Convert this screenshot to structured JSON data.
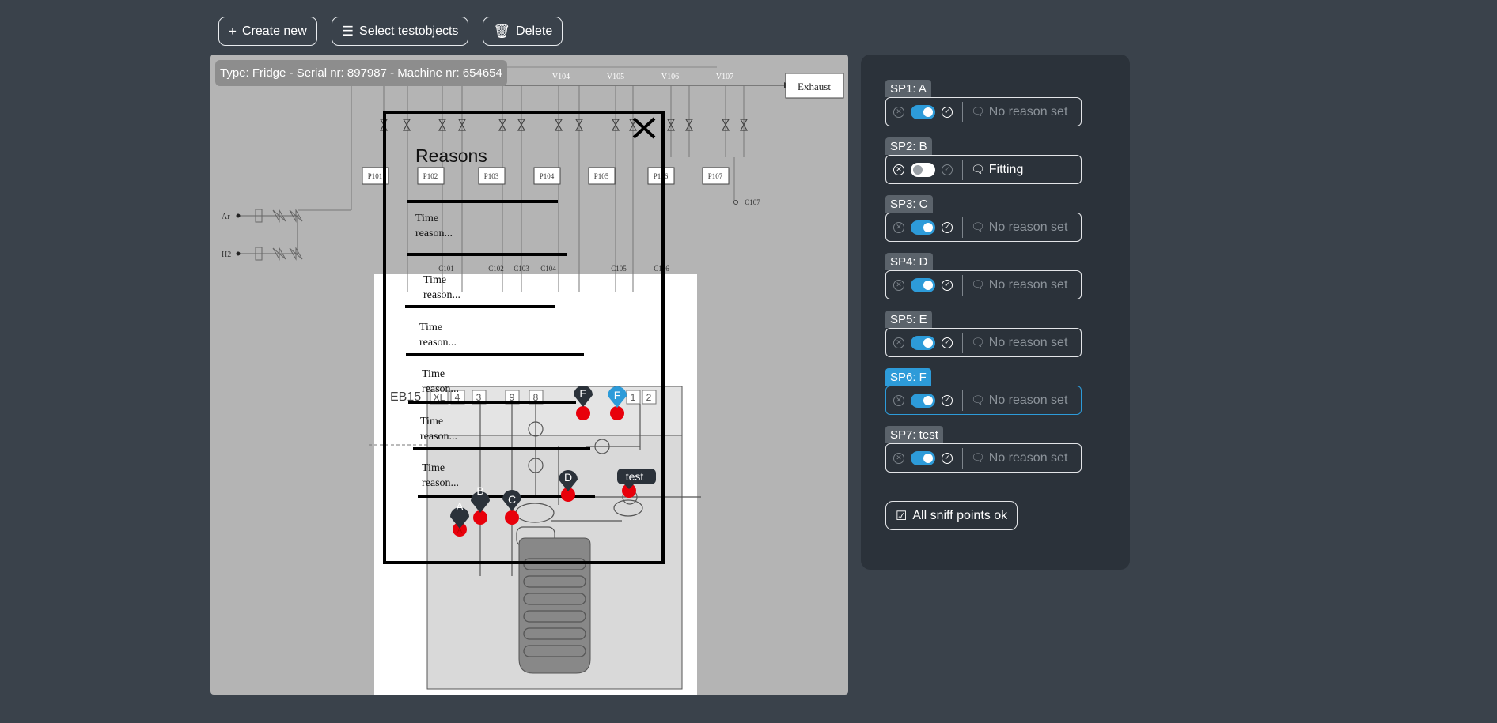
{
  "toolbar": {
    "create_label": "Create new",
    "select_label": "Select testobjects",
    "delete_label": "Delete"
  },
  "viewer": {
    "info": "Type: Fridge - Serial nr: 897987 - Machine nr: 654654",
    "diagram_labels": {
      "exhaust": "Exhaust",
      "ar": "Ar",
      "h2": "H2",
      "valves": [
        "V104",
        "V105",
        "V106",
        "V107"
      ],
      "pumps": [
        "P101",
        "P102",
        "P103",
        "P104",
        "P105",
        "P106",
        "P107"
      ],
      "columns": [
        "C101",
        "C102",
        "C103",
        "C104",
        "C105",
        "C106",
        "C107"
      ],
      "eb15": "EB15",
      "xl": "XL",
      "port_numbers": [
        "4",
        "3",
        "9",
        "8",
        "1",
        "2"
      ]
    },
    "reasons_overlay": {
      "title": "Reasons",
      "items": [
        "Time reason...",
        "Time reason...",
        "Time reason...",
        "Time reason...",
        "Time reason...",
        "Time reason..."
      ]
    },
    "markers": [
      "A",
      "B",
      "C",
      "D",
      "E",
      "F",
      "test"
    ],
    "selected_marker": "F"
  },
  "sniff_points": [
    {
      "label": "SP1: A",
      "enabled": true,
      "reason": "No reason set",
      "reason_set": false
    },
    {
      "label": "SP2: B",
      "enabled": false,
      "reason": "Fitting",
      "reason_set": true
    },
    {
      "label": "SP3: C",
      "enabled": true,
      "reason": "No reason set",
      "reason_set": false
    },
    {
      "label": "SP4: D",
      "enabled": true,
      "reason": "No reason set",
      "reason_set": false
    },
    {
      "label": "SP5: E",
      "enabled": true,
      "reason": "No reason set",
      "reason_set": false
    },
    {
      "label": "SP6: F",
      "enabled": true,
      "reason": "No reason set",
      "reason_set": false,
      "active": true
    },
    {
      "label": "SP7: test",
      "enabled": true,
      "reason": "No reason set",
      "reason_set": false
    }
  ],
  "all_ok_label": "All sniff points ok",
  "colors": {
    "accent": "#2d9bd9",
    "marker_red": "#e8000b",
    "marker_dark": "#2b323a"
  }
}
